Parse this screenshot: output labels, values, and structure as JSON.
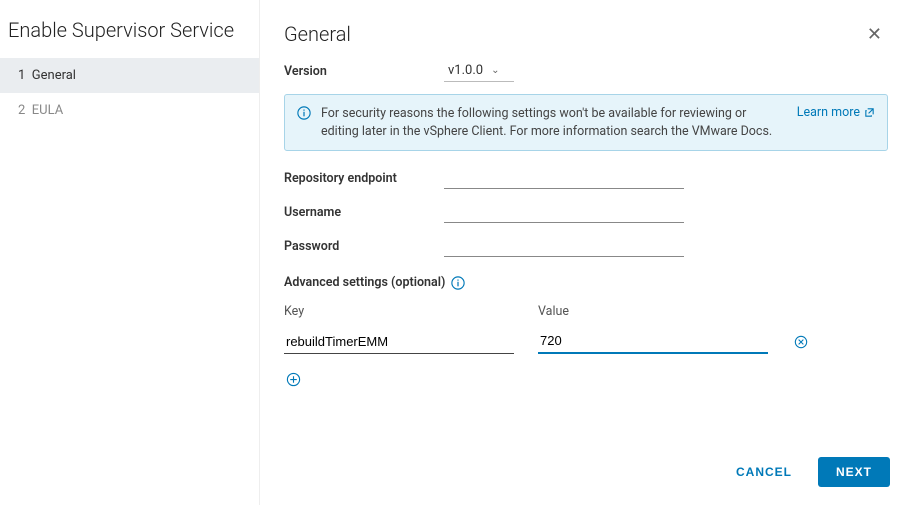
{
  "sidebar": {
    "title": "Enable Supervisor Service",
    "steps": [
      {
        "num": "1",
        "label": "General",
        "active": true
      },
      {
        "num": "2",
        "label": "EULA",
        "active": false
      }
    ]
  },
  "main": {
    "title": "General",
    "version": {
      "label": "Version",
      "selected": "v1.0.0"
    },
    "banner": {
      "text": "For security reasons the following settings won't be available for reviewing or editing later in the vSphere Client. For more information search the VMware Docs.",
      "learn_more": "Learn more"
    },
    "fields": {
      "repo_label": "Repository endpoint",
      "repo_value": "",
      "user_label": "Username",
      "user_value": "",
      "pass_label": "Password",
      "pass_value": ""
    },
    "advanced": {
      "label": "Advanced settings (optional)",
      "key_header": "Key",
      "value_header": "Value",
      "rows": [
        {
          "key": "rebuildTimerEMM",
          "value": "720"
        }
      ]
    }
  },
  "footer": {
    "cancel": "CANCEL",
    "next": "NEXT"
  }
}
